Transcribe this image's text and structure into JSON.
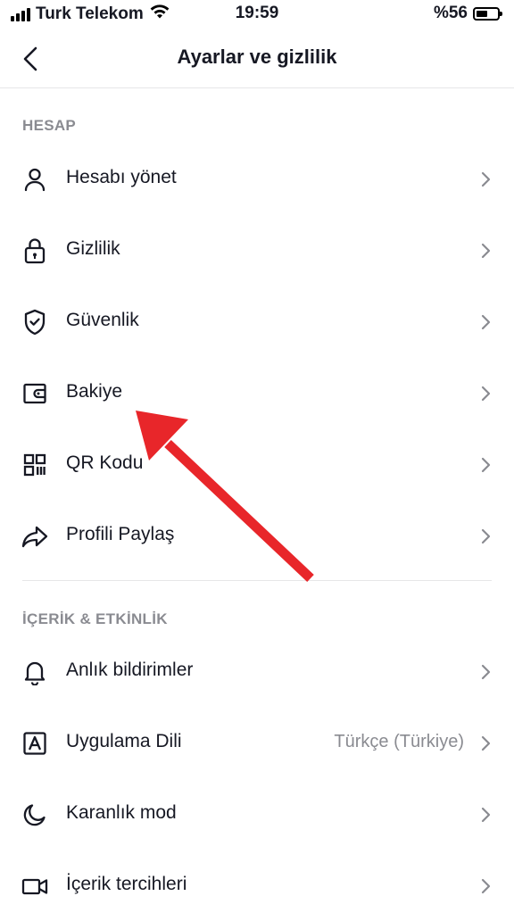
{
  "status_bar": {
    "carrier": "Turk Telekom",
    "time": "19:59",
    "battery": "%56",
    "battery_level": 0.56
  },
  "header": {
    "title": "Ayarlar ve gizlilik"
  },
  "sections": [
    {
      "label": "HESAP",
      "items": [
        {
          "label": "Hesabı yönet",
          "icon": "person-icon"
        },
        {
          "label": "Gizlilik",
          "icon": "lock-icon"
        },
        {
          "label": "Güvenlik",
          "icon": "shield-icon"
        },
        {
          "label": "Bakiye",
          "icon": "wallet-icon"
        },
        {
          "label": "QR Kodu",
          "icon": "qr-code-icon"
        },
        {
          "label": "Profili Paylaş",
          "icon": "share-icon"
        }
      ]
    },
    {
      "label": "İÇERİK & ETKİNLİK",
      "items": [
        {
          "label": "Anlık bildirimler",
          "icon": "bell-icon"
        },
        {
          "label": "Uygulama Dili",
          "icon": "language-icon",
          "value": "Türkçe (Türkiye)"
        },
        {
          "label": "Karanlık mod",
          "icon": "moon-icon"
        },
        {
          "label": "İçerik tercihleri",
          "icon": "video-camera-icon"
        }
      ]
    }
  ],
  "annotation": {
    "color": "#e8262a"
  }
}
